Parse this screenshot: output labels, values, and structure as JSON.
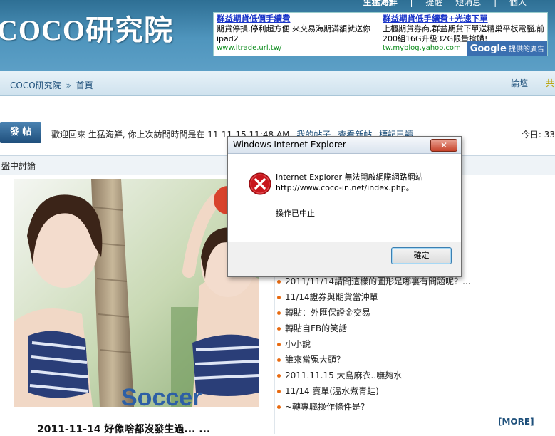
{
  "header": {
    "logo": "COCO研究院",
    "top_links": [
      "生猛海鮮",
      "|",
      "提醒",
      "短消息",
      "|",
      "個人"
    ]
  },
  "ads": [
    {
      "title": "群益期貨低價手續費",
      "body": "期貨停損,停利超方便 來交易海期滿額就送你ipad2",
      "url": "www.itrade.url.tw/"
    },
    {
      "title": "群益期貨低手續費+光速下單",
      "body": "上櫃期貨券商,群益期貨下單送精巢平板電腦,前200組16G升級32G限量搶購!",
      "url": "tw.myblog.yahoo.com"
    }
  ],
  "google_badge": {
    "brand": "Google",
    "text": "提供的廣告"
  },
  "nav": {
    "crumb_home": "COCO研究院",
    "crumb_sep": "»",
    "crumb_current": "首頁",
    "forum": "論壇",
    "extra": "共"
  },
  "toolbar": {
    "post_button": "發 帖",
    "welcome": "歡迎回來 生猛海鮮, 你上次訪問時間是在 11-11-15 11:48 AM",
    "links": [
      "我的帖子",
      "查看新帖",
      "標記已讀"
    ],
    "today": "今日: 33"
  },
  "section": {
    "title": "盤中討論"
  },
  "photo_caption": "2011-11-14 好像啥都沒發生過... ...",
  "photo_text": "Soccer",
  "threads": [
    "2011/11/14請問這樣的圖形是哪裏有問題呢？...",
    "11/14證券與期貨當沖單",
    "轉貼：外匯保證金交易",
    "轉貼自FB的笑話",
    "小小說",
    "誰來當冤大頭？",
    "2011.11.15 大島麻衣..嘸夠水",
    "11/14 賣單(溫水煮青蛙)",
    "~轉專職操作條件是?"
  ],
  "more": "[MORE]",
  "dialog": {
    "title": "Windows Internet Explorer",
    "close": "✕",
    "message_line1": "Internet Explorer 無法開啟網際網路網站",
    "message_line2": "http://www.coco-in.net/index.php。",
    "status": "操作已中止",
    "ok": "確定"
  }
}
